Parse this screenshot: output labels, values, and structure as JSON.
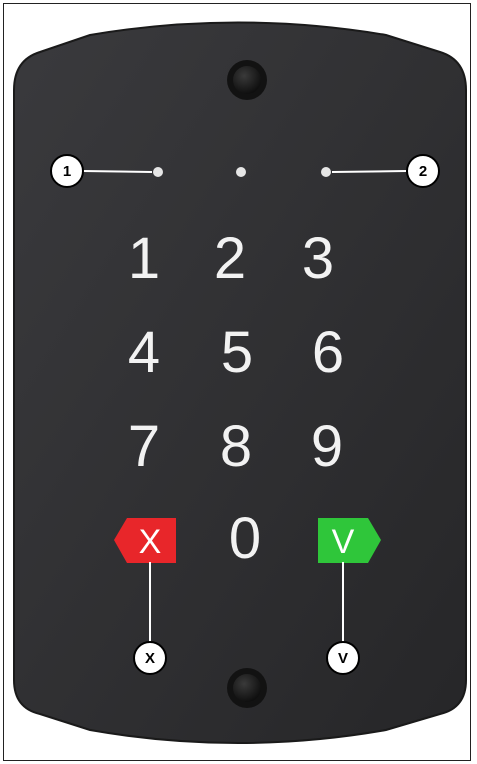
{
  "keypad": {
    "keys": {
      "k1": "1",
      "k2": "2",
      "k3": "3",
      "k4": "4",
      "k5": "5",
      "k6": "6",
      "k7": "7",
      "k8": "8",
      "k9": "9",
      "k0": "0",
      "cancel": "X",
      "confirm": "V"
    },
    "colors": {
      "body": "#2e2e30",
      "cancel": "#e8262a",
      "confirm": "#2fc63a"
    }
  },
  "callouts": {
    "c1": "1",
    "c2": "2",
    "cx": "X",
    "cv": "V"
  }
}
